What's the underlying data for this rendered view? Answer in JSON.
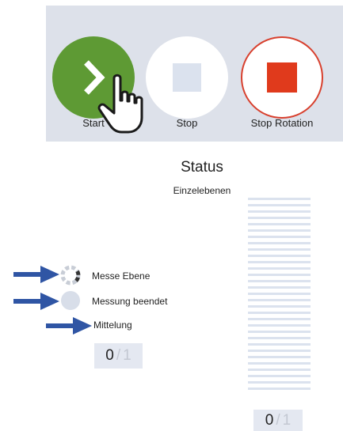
{
  "toolbar": {
    "start_label": "Start",
    "stop_label": "Stop",
    "stop_rotation_label": "Stop Rotation",
    "colors": {
      "background": "#dde1ea",
      "start": "#5e9a34",
      "stop_square": "#dbe2ee",
      "stop_rotation_square": "#e03a1c",
      "stop_rotation_ring": "#d8402e"
    }
  },
  "status": {
    "title": "Status",
    "subtitle": "Einzelebenen",
    "counter_right": {
      "current": "0",
      "separator": "/",
      "total": "1"
    }
  },
  "legend": {
    "measuring_label": "Messe Ebene",
    "finished_label": "Messung beendet",
    "averaging_label": "Mittelung",
    "counter_left": {
      "current": "0",
      "separator": "/",
      "total": "1"
    }
  },
  "icons": [
    "play-chevron-icon",
    "stop-square-icon",
    "stop-rotation-square-icon",
    "hand-cursor-icon",
    "arrow-icon",
    "dashed-circle-icon",
    "filled-circle-icon"
  ]
}
